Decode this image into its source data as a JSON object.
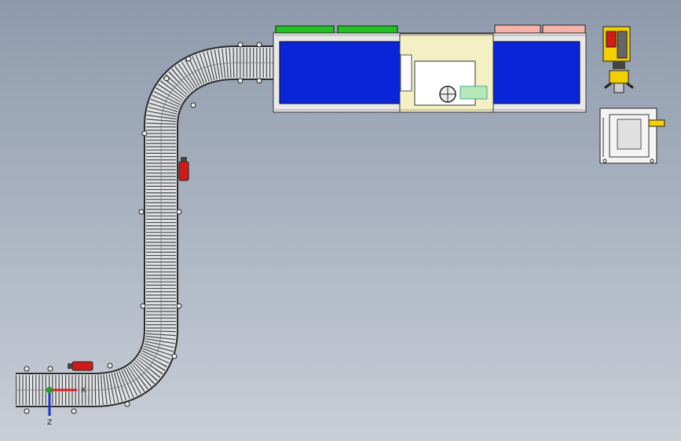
{
  "scene": {
    "background_top": "#8e9aac",
    "background_bottom": "#c9ced7",
    "conveyor_color": "#d9dcdf",
    "frame_color": "#2a2a2a",
    "chamber_color": "#0a24d8",
    "panel_color": "#f5f0c4",
    "green_tag_color": "#22c022",
    "pink_tag_color": "#f3b3a8",
    "motor_color": "#d11a1a",
    "robot_color": "#f2d000"
  },
  "axes": {
    "x_label": "X",
    "z_label": "Z",
    "x_color": "#e02020",
    "y_color": "#20a020",
    "z_color": "#2030d0"
  },
  "components": {
    "conveyor": "roller-conveyor-icon",
    "motors": "motor-icon",
    "chamber": "process-chamber-icon",
    "robot": "robot-arm-icon",
    "station": "workstation-icon"
  }
}
